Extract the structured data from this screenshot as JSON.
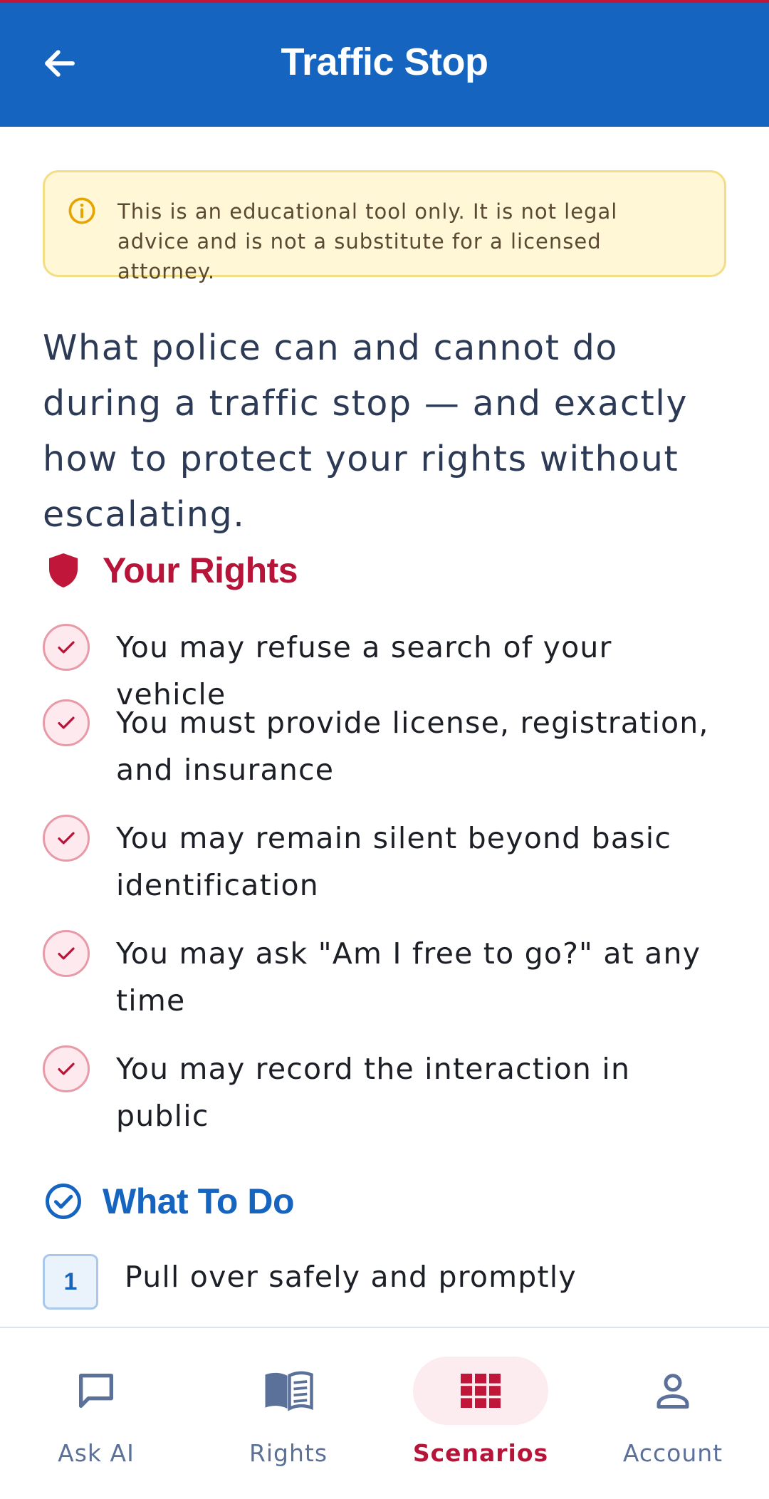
{
  "colors": {
    "header_bg": "#1565c0",
    "accent_red": "#b8143a",
    "accent_blue": "#1565c0",
    "disclaimer_bg": "#fff7d6",
    "nav_inactive": "#5c7199"
  },
  "header": {
    "title": "Traffic Stop",
    "back_icon": "arrow-left-icon"
  },
  "disclaimer": {
    "icon": "info-icon",
    "text": "This is an educational tool only. It is not legal advice and is not a substitute for a licensed attorney."
  },
  "intro": "What police can and cannot do during a traffic stop — and exactly how to protect your rights without escalating.",
  "rights": {
    "icon": "shield-icon",
    "title": "Your Rights",
    "items": [
      {
        "label": "You may refuse a search of your vehicle"
      },
      {
        "label": "You must provide license, registration, and insurance"
      },
      {
        "label": "You may remain silent beyond basic identification"
      },
      {
        "label": "You may ask \"Am I free to go?\" at any time"
      },
      {
        "label": "You may record the interaction in public"
      }
    ]
  },
  "what_to_do": {
    "icon": "check-circle-icon",
    "title": "What To Do",
    "steps": [
      {
        "number": "1",
        "label": "Pull over safely and promptly"
      }
    ]
  },
  "nav": {
    "items": [
      {
        "label": "Ask AI",
        "icon": "chat-bubble-icon",
        "active": false
      },
      {
        "label": "Rights",
        "icon": "book-icon",
        "active": false
      },
      {
        "label": "Scenarios",
        "icon": "grid-icon",
        "active": true
      },
      {
        "label": "Account",
        "icon": "person-icon",
        "active": false
      }
    ]
  }
}
